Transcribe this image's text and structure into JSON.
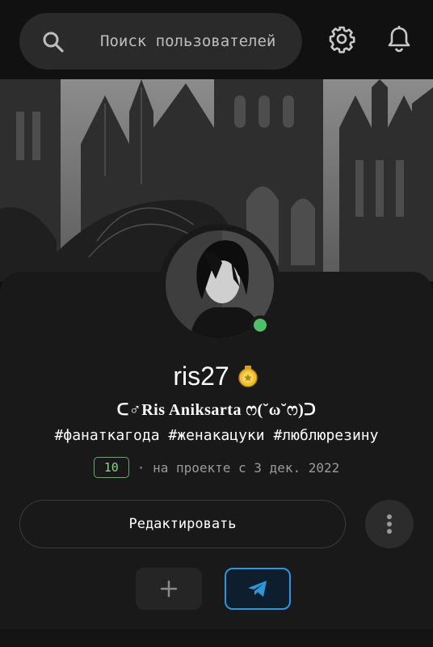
{
  "search": {
    "placeholder": "Поиск пользователей"
  },
  "profile": {
    "username": "ris27",
    "display_name": "ᑕ♂Ris Aniksarta ෆ(˘ω˘ෆ)ᑐ",
    "tags": "#фанаткагода #женакацуки #люблюрезину",
    "level": "10",
    "since": "· на проекте с 3 дек. 2022",
    "online": true
  },
  "actions": {
    "edit_label": "Редактировать"
  },
  "icons": {
    "search": "search-icon",
    "settings": "gear-icon",
    "notifications": "bell-icon",
    "badge": "medal-icon",
    "more": "more-vertical-icon",
    "add": "plus-icon",
    "telegram": "telegram-icon"
  },
  "colors": {
    "accent": "#2a98df",
    "online": "#4fbf6a",
    "level": "#58b25f"
  }
}
